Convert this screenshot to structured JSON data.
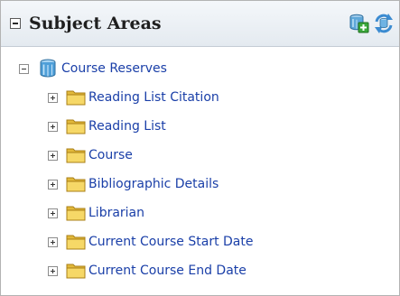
{
  "panel": {
    "title": "Subject Areas",
    "toolbar": {
      "add_icon": "add-subject-area-icon",
      "refresh_icon": "refresh-icon"
    }
  },
  "tree": {
    "root": {
      "label": "Course Reserves",
      "icon": "subject-area-cylinder-icon",
      "expanded": true
    },
    "folders": [
      {
        "label": "Reading List Citation",
        "icon": "folder-icon",
        "expanded": false
      },
      {
        "label": "Reading List",
        "icon": "folder-icon",
        "expanded": false
      },
      {
        "label": "Course",
        "icon": "folder-icon",
        "expanded": false
      },
      {
        "label": "Bibliographic Details",
        "icon": "folder-icon",
        "expanded": false
      },
      {
        "label": "Librarian",
        "icon": "folder-icon",
        "expanded": false
      },
      {
        "label": "Current Course Start Date",
        "icon": "folder-icon",
        "expanded": false
      },
      {
        "label": "Current Course End Date",
        "icon": "folder-icon",
        "expanded": false
      }
    ]
  },
  "colors": {
    "link": "#1a3fa8",
    "folder": "#f0cc4c",
    "header_bg": "#e8edf2"
  }
}
